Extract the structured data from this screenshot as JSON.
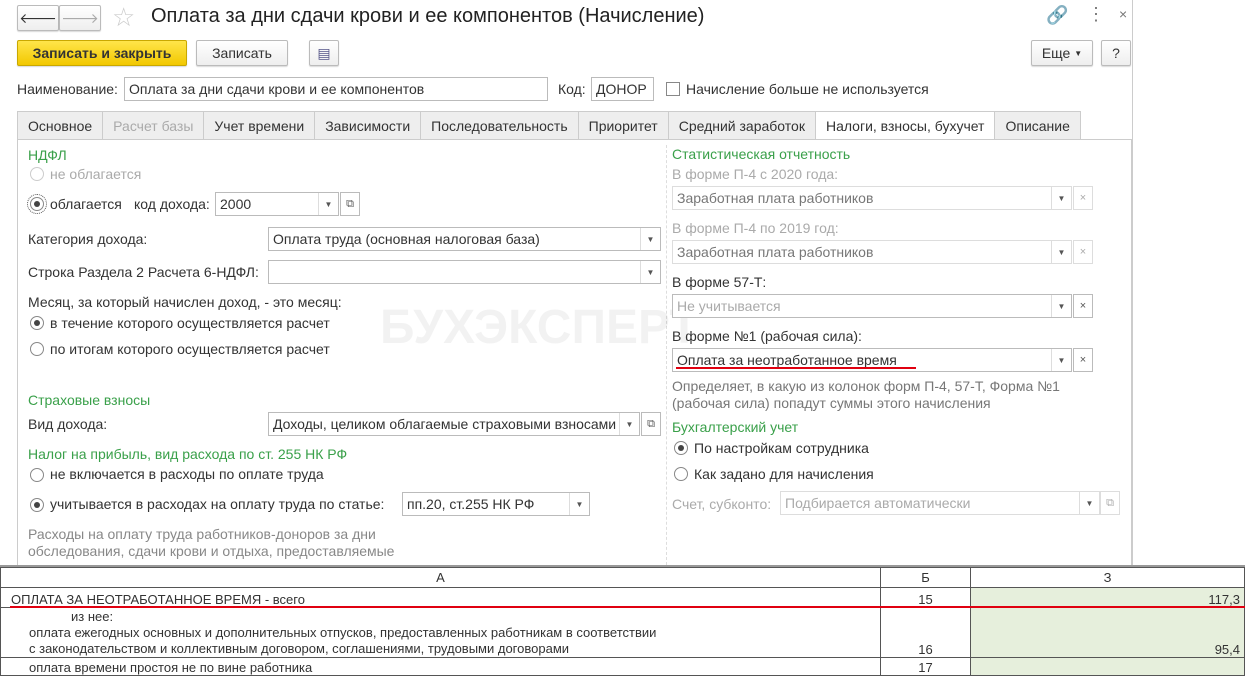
{
  "window": {
    "title": "Оплата за дни сдачи крови и ее компонентов (Начисление)"
  },
  "toolbar": {
    "save_close": "Записать и закрыть",
    "save": "Записать",
    "more": "Еще",
    "help": "?"
  },
  "header": {
    "name_label": "Наименование:",
    "name_value": "Оплата за дни сдачи крови и ее компонентов",
    "code_label": "Код:",
    "code_value": "ДОНОР",
    "unused_label": "Начисление больше не используется"
  },
  "tabs": [
    "Основное",
    "Расчет базы",
    "Учет времени",
    "Зависимости",
    "Последовательность",
    "Приоритет",
    "Средний заработок",
    "Налоги, взносы, бухучет",
    "Описание"
  ],
  "left": {
    "ndfl_title": "НДФЛ",
    "not_taxed": "не облагается",
    "taxed": "облагается",
    "income_code_label": "код дохода:",
    "income_code": "2000",
    "category_label": "Категория дохода:",
    "category_value": "Оплата труда (основная налоговая база)",
    "row6_label": "Строка Раздела 2 Расчета 6-НДФЛ:",
    "row6_value": "",
    "month_label": "Месяц, за который начислен доход, - это месяц:",
    "month_opt1": "в течение которого осуществляется расчет",
    "month_opt2": "по итогам которого осуществляется расчет",
    "insurance_title": "Страховые взносы",
    "income_type_label": "Вид дохода:",
    "income_type_value": "Доходы, целиком облагаемые страховыми взносами",
    "profit_title": "Налог на прибыль, вид расхода по ст. 255 НК РФ",
    "profit_opt1": "не включается в расходы по оплате труда",
    "profit_opt2": "учитывается в расходах на оплату труда по статье:",
    "profit_article": "пп.20, ст.255 НК РФ",
    "note": "Расходы на оплату труда работников-доноров за дни обследования, сдачи крови и отдыха, предоставляемые"
  },
  "right": {
    "stat_title": "Статистическая отчетность",
    "p4_2020_label": "В форме П-4 с 2020 года:",
    "p4_2020_value": "Заработная плата работников",
    "p4_2019_label": "В форме П-4 по 2019 год:",
    "p4_2019_value": "Заработная плата работников",
    "f57_label": "В форме 57-Т:",
    "f57_placeholder": "Не учитывается",
    "f1_label": "В форме №1 (рабочая сила):",
    "f1_value": "Оплата за неотработанное время",
    "hint": "Определяет, в какую из колонок форм П-4, 57-Т, Форма №1 (рабочая сила) попадут суммы этого начисления",
    "acc_title": "Бухгалтерский учет",
    "acc_opt1": "По настройкам сотрудника",
    "acc_opt2": "Как задано для начисления",
    "account_label": "Счет, субконто:",
    "account_placeholder": "Подбирается автоматически"
  },
  "watermark": "БУХЭКСПЕРТ",
  "sheet": {
    "headers": [
      "А",
      "Б",
      "З"
    ],
    "rows": [
      {
        "a": "ОПЛАТА ЗА НЕОТРАБОТАННОЕ ВРЕМЯ - всего",
        "b": "15",
        "c": "117,3"
      },
      {
        "a_pre": "из нее:",
        "a1": "оплата ежегодных основных и дополнительных отпусков, предоставленных работникам в соответствии",
        "a2": "с законодательством и коллективным договором, соглашениями, трудовыми договорами",
        "b": "16",
        "c": "95,4"
      },
      {
        "a": "оплата времени простоя не по вине работника",
        "b": "17",
        "c": ""
      }
    ]
  },
  "colors": {
    "accent": "#3aa04a",
    "highlight": "#e00010",
    "cell": "#e6efdc"
  }
}
